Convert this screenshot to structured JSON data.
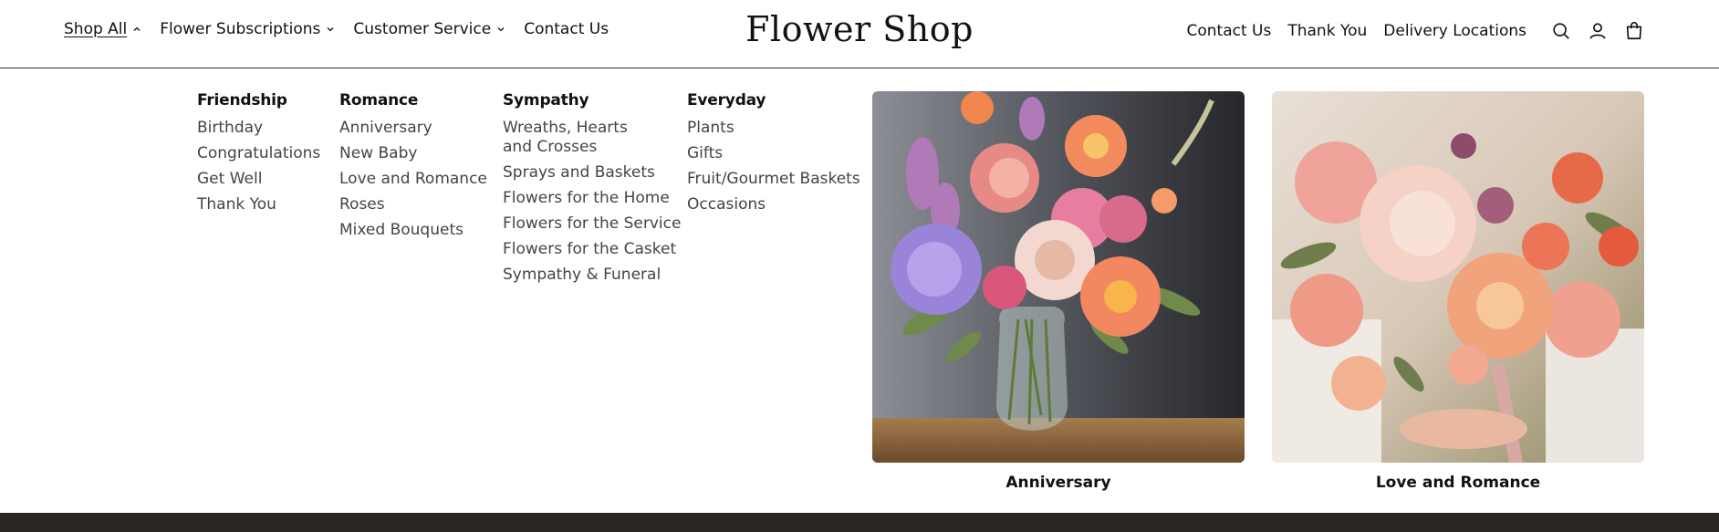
{
  "header": {
    "nav_left": [
      {
        "label": "Shop All",
        "chevron": "up",
        "active": true
      },
      {
        "label": "Flower Subscriptions",
        "chevron": "down"
      },
      {
        "label": "Customer Service",
        "chevron": "down"
      },
      {
        "label": "Contact Us"
      }
    ],
    "logo": "Flower Shop",
    "nav_right": [
      "Contact Us",
      "Thank You",
      "Delivery Locations"
    ],
    "icons": [
      "search-icon",
      "account-icon",
      "cart-icon"
    ]
  },
  "menu": {
    "columns": [
      {
        "heading": "Friendship",
        "items": [
          "Birthday",
          "Congratulations",
          "Get Well",
          "Thank You"
        ]
      },
      {
        "heading": "Romance",
        "items": [
          "Anniversary",
          "New Baby",
          "Love and Romance",
          "Roses",
          "Mixed Bouquets"
        ]
      },
      {
        "heading": "Sympathy",
        "items": [
          "Wreaths, Hearts and Crosses",
          "Sprays and Baskets",
          "Flowers for the Home",
          "Flowers for the Service",
          "Flowers for the Casket",
          "Sympathy & Funeral"
        ]
      },
      {
        "heading": "Everyday",
        "items": [
          "Plants",
          "Gifts",
          "Fruit/Gourmet Baskets",
          "Occasions"
        ]
      }
    ],
    "featured": [
      {
        "caption": "Anniversary"
      },
      {
        "caption": "Love and Romance"
      }
    ]
  },
  "colors": {
    "footer_strip": "#2a2523",
    "divider": "#333333"
  }
}
